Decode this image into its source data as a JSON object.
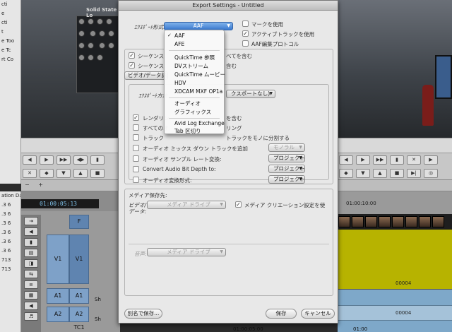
{
  "background": {
    "left_list": [
      "cti",
      "e",
      "cti",
      "t",
      "e Too",
      "e Tc",
      "rt Co",
      "",
      "",
      "",
      "",
      "",
      "",
      "",
      "",
      "",
      "",
      "",
      ""
    ],
    "video_banner": "Solid State Lo",
    "timeline_toolbar": {
      "minus": "−",
      "plus": "+"
    },
    "timecode": "01:00:05:13",
    "bins_left": [
      "ation Da",
      ".3 6",
      ".3 6",
      ".3 6",
      ".3 6",
      ".3 6",
      ".3 6",
      "713",
      "713"
    ],
    "tracks": {
      "f_header": "F",
      "v1": "V1",
      "v1b": "V1",
      "a1": "A1",
      "a1b": "A1",
      "a2": "A2",
      "a2b": "A2",
      "tc1": "TC1",
      "sh": "Sh",
      "sh2": "Sh"
    },
    "ruler_r": "01:00:10:00",
    "ruler_b1": "01:00",
    "ruler_b2": "01:00:05:00",
    "clip_label_1": "00004",
    "clip_label_2": "00004"
  },
  "dialog": {
    "title": "Export Settings - Untitled",
    "export_format_label": "ｴｸｽﾎﾟｰﾄ形式:",
    "export_format_value": "AAF",
    "right_checks": [
      {
        "label": "マークを使用",
        "checked": false
      },
      {
        "label": "アクティブトラックを使用",
        "checked": true
      },
      {
        "label": "AAF編集プロトコル",
        "checked": false
      }
    ],
    "seq_check_1": "シーケンス",
    "seq_check_1_tail": "べてを含む",
    "seq_check_2": "シーケンス",
    "seq_check_2_tail": "含む",
    "video_tab": "ビデオ/データ詳細",
    "export_method_label": "ｴｸｽﾎﾟｰﾄ方法",
    "export_method_value": "クスポートなし)",
    "render_check": "レンダリン",
    "render_tail": "を含む",
    "all_check": "すべてのオ",
    "all_tail": "リング",
    "track_split_label": "トラック",
    "track_split_tail": "トラックをモノに分割する",
    "audio_mixdown_label": "オーディオ ミックス ダウン トラックを追加",
    "audio_mixdown_value": "モノラル",
    "sample_rate_label": "オーディオ サンプル レート変換:",
    "sample_rate_value": "プロジェクト",
    "bit_depth_label": "Convert Audio Bit Depth to:",
    "bit_depth_value": "プロジェクト",
    "format_conv_label": "オーディオ変換形式:",
    "format_conv_value": "プロジェクト",
    "media_dest_label": "メディア保存先:",
    "video_data_label": "ビデオ/\nデータ:",
    "video_media_drive": "メディア ドライブ",
    "media_creation_check": "メディア クリエーション設定を使",
    "audio_label": "音声:",
    "audio_media_drive": "メディア ドライブ",
    "save_as_button": "別名で保存...",
    "save_button": "保存",
    "cancel_button": "キャンセル"
  },
  "format_menu": {
    "checked": "AAF",
    "items": [
      "AAF",
      "AFE",
      "QuickTime 参照",
      "DVストリーム",
      "QuickTime ムービー",
      "HDV",
      "XDCAM MXF OP1a",
      "オーディオ",
      "グラフィックス",
      "Avid Log Exchange",
      "Tab 区切り"
    ]
  }
}
